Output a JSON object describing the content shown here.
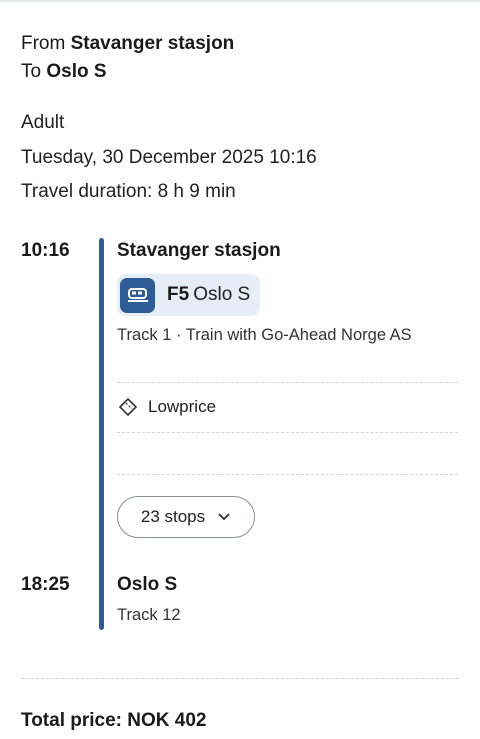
{
  "route": {
    "from_label": "From",
    "from_station": "Stavanger stasjon",
    "to_label": "To",
    "to_station": "Oslo S"
  },
  "info": {
    "passenger": "Adult",
    "date_time": "Tuesday, 30 December 2025 10:16",
    "duration": "Travel duration: 8 h 9 min"
  },
  "journey": {
    "departure_time": "10:16",
    "departure_station": "Stavanger stasjon",
    "train_line": "F5",
    "train_destination": "Oslo S",
    "departure_track": "Track 1 · Train with Go-Ahead Norge AS",
    "fare_label": "Lowprice",
    "stops_label": "23 stops",
    "arrival_time": "18:25",
    "arrival_station": "Oslo S",
    "arrival_track": "Track 12",
    "line_color": "#2f5b96"
  },
  "total_price": "Total price: NOK 402"
}
